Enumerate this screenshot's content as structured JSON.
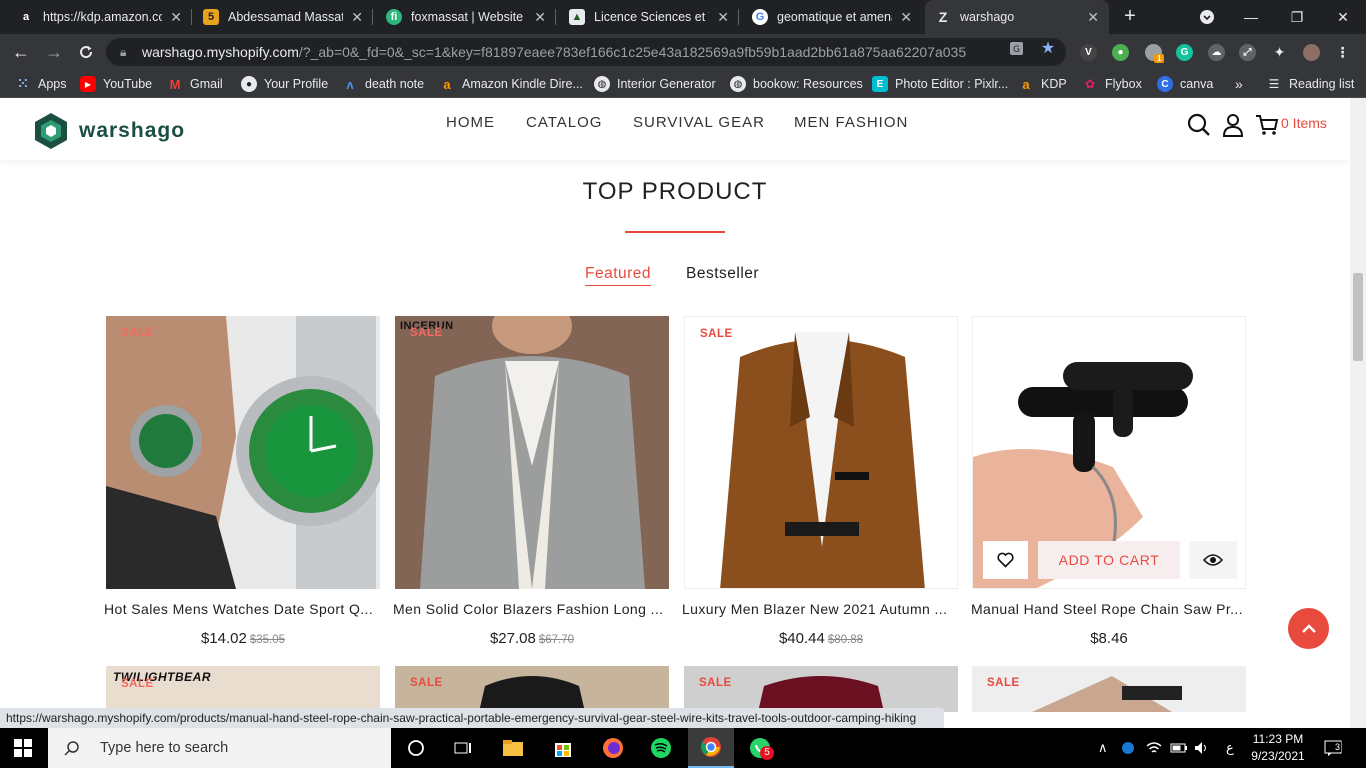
{
  "browser": {
    "tabs": [
      {
        "title": "https://kdp.amazon.co",
        "icon": "amazon-icon"
      },
      {
        "title": "Abdessamad Massat -",
        "icon": "five-icon"
      },
      {
        "title": "foxmassat | Website C",
        "icon": "fi-icon"
      },
      {
        "title": "Licence Sciences et Te",
        "icon": "grad-cap-icon"
      },
      {
        "title": "geomatique et amena",
        "icon": "google-icon"
      },
      {
        "title": "warshago",
        "icon": "zeeg-icon",
        "active": true
      }
    ],
    "url_main": "warshago.myshopify.com",
    "url_rest": "/?_ab=0&_fd=0&_sc=1&key=f81897eaee783ef166c1c25e43a182569a9fb59b1aad2bb61a875aa62207a035",
    "ext_badge": "1",
    "bookmarks": [
      "Apps",
      "YouTube",
      "Gmail",
      "Your Profile",
      "death note",
      "Amazon Kindle Dire...",
      "Interior Generator",
      "bookow: Resources",
      "Photo Editor : Pixlr...",
      "KDP",
      "Flybox",
      "canva"
    ],
    "more_bookmarks": "»",
    "reading_list": "Reading list"
  },
  "site": {
    "logo": "warshago",
    "nav": [
      "HOME",
      "CATALOG",
      "SURVIVAL GEAR",
      "MEN FASHION"
    ],
    "cart_count": "0 Items",
    "section_title": "TOP PRODUCT",
    "product_tabs": [
      "Featured",
      "Bestseller"
    ],
    "sale_label": "SALE",
    "add_to_cart": "ADD TO CART",
    "products": [
      {
        "name": "Hot Sales Mens Watches Date Sport Q...",
        "price": "$14.02",
        "old_price": "$35.05",
        "brand": ""
      },
      {
        "name": "Men Solid Color Blazers Fashion Long ...",
        "price": "$27.08",
        "old_price": "$67.70",
        "brand": "INCERUN"
      },
      {
        "name": "Luxury Men Blazer New 2021 Autumn ...",
        "price": "$40.44",
        "old_price": "$80.88",
        "brand": ""
      },
      {
        "name": "Manual Hand Steel Rope Chain Saw Pr...",
        "price": "$8.46",
        "old_price": "",
        "brand": ""
      }
    ],
    "bottom_row_brand": "TWILIGHTBEAR"
  },
  "status_url": "https://warshago.myshopify.com/products/manual-hand-steel-rope-chain-saw-practical-portable-emergency-survival-gear-steel-wire-kits-travel-tools-outdoor-camping-hiking",
  "taskbar": {
    "search_placeholder": "Type here to search",
    "whatsapp_badge": "5",
    "time": "11:23 PM",
    "date": "9/23/2021",
    "lang": "ع",
    "notif_count": "3"
  },
  "colors": {
    "accent": "#e84a3e",
    "logo": "#1c4f43",
    "chrome_dark": "#35363a"
  }
}
